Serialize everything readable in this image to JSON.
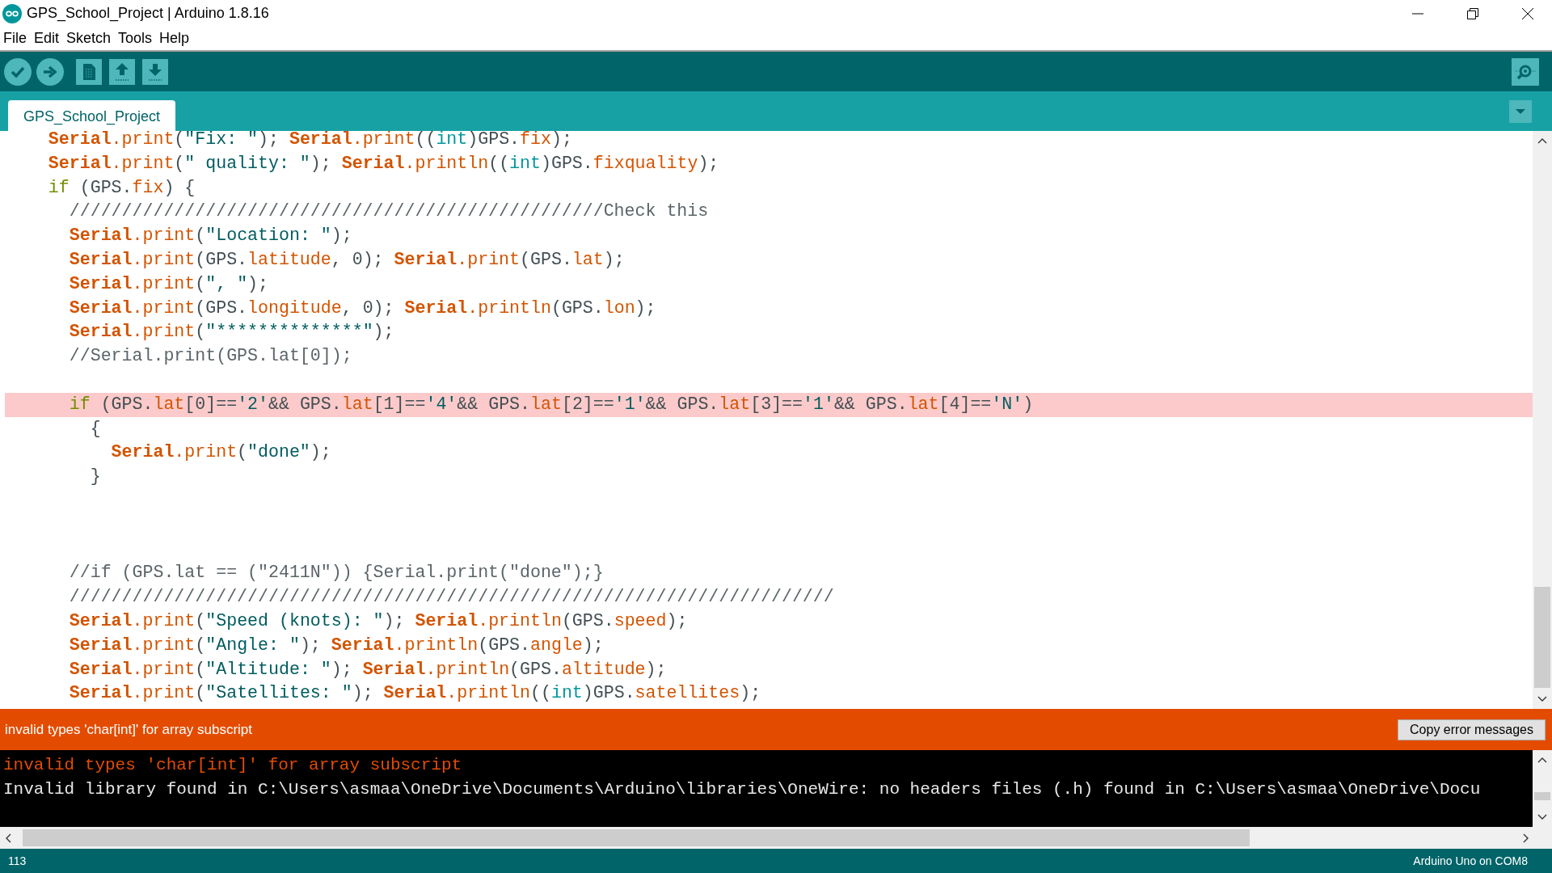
{
  "window": {
    "title": "GPS_School_Project | Arduino 1.8.16"
  },
  "menu": [
    "File",
    "Edit",
    "Sketch",
    "Tools",
    "Help"
  ],
  "tabs": [
    {
      "label": "GPS_School_Project",
      "selected": true
    }
  ],
  "code": [
    {
      "kind": "code",
      "error": false,
      "segments": [
        {
          "kind": "obj",
          "text": "    Serial"
        },
        {
          "kind": "fn",
          "text": ".print"
        },
        {
          "kind": "plain",
          "text": "("
        },
        {
          "kind": "str",
          "text": "\"Fix: \""
        },
        {
          "kind": "plain",
          "text": "); "
        },
        {
          "kind": "obj",
          "text": "Serial"
        },
        {
          "kind": "fn",
          "text": ".print"
        },
        {
          "kind": "plain",
          "text": "(("
        },
        {
          "kind": "type",
          "text": "int"
        },
        {
          "kind": "plain",
          "text": ")GPS."
        },
        {
          "kind": "prop",
          "text": "fix"
        },
        {
          "kind": "plain",
          "text": ");"
        }
      ]
    },
    {
      "kind": "code",
      "error": false,
      "segments": [
        {
          "kind": "obj",
          "text": "    Serial"
        },
        {
          "kind": "fn",
          "text": ".print"
        },
        {
          "kind": "plain",
          "text": "("
        },
        {
          "kind": "str",
          "text": "\" quality: \""
        },
        {
          "kind": "plain",
          "text": "); "
        },
        {
          "kind": "obj",
          "text": "Serial"
        },
        {
          "kind": "fn",
          "text": ".println"
        },
        {
          "kind": "plain",
          "text": "(("
        },
        {
          "kind": "type",
          "text": "int"
        },
        {
          "kind": "plain",
          "text": ")GPS."
        },
        {
          "kind": "prop",
          "text": "fixquality"
        },
        {
          "kind": "plain",
          "text": ");"
        }
      ]
    },
    {
      "kind": "code",
      "error": false,
      "segments": [
        {
          "kind": "kw",
          "text": "    if"
        },
        {
          "kind": "plain",
          "text": " (GPS."
        },
        {
          "kind": "prop",
          "text": "fix"
        },
        {
          "kind": "plain",
          "text": ") {"
        }
      ]
    },
    {
      "kind": "code",
      "error": false,
      "segments": [
        {
          "kind": "cmt",
          "text": "      ///////////////////////////////////////////////////Check this"
        }
      ]
    },
    {
      "kind": "code",
      "error": false,
      "segments": [
        {
          "kind": "obj",
          "text": "      Serial"
        },
        {
          "kind": "fn",
          "text": ".print"
        },
        {
          "kind": "plain",
          "text": "("
        },
        {
          "kind": "str",
          "text": "\"Location: \""
        },
        {
          "kind": "plain",
          "text": ");"
        }
      ]
    },
    {
      "kind": "code",
      "error": false,
      "segments": [
        {
          "kind": "obj",
          "text": "      Serial"
        },
        {
          "kind": "fn",
          "text": ".print"
        },
        {
          "kind": "plain",
          "text": "(GPS."
        },
        {
          "kind": "prop",
          "text": "latitude"
        },
        {
          "kind": "plain",
          "text": ", 0); "
        },
        {
          "kind": "obj",
          "text": "Serial"
        },
        {
          "kind": "fn",
          "text": ".print"
        },
        {
          "kind": "plain",
          "text": "(GPS."
        },
        {
          "kind": "prop",
          "text": "lat"
        },
        {
          "kind": "plain",
          "text": ");"
        }
      ]
    },
    {
      "kind": "code",
      "error": false,
      "segments": [
        {
          "kind": "obj",
          "text": "      Serial"
        },
        {
          "kind": "fn",
          "text": ".print"
        },
        {
          "kind": "plain",
          "text": "("
        },
        {
          "kind": "str",
          "text": "\", \""
        },
        {
          "kind": "plain",
          "text": ");"
        }
      ]
    },
    {
      "kind": "code",
      "error": false,
      "segments": [
        {
          "kind": "obj",
          "text": "      Serial"
        },
        {
          "kind": "fn",
          "text": ".print"
        },
        {
          "kind": "plain",
          "text": "(GPS."
        },
        {
          "kind": "prop",
          "text": "longitude"
        },
        {
          "kind": "plain",
          "text": ", 0); "
        },
        {
          "kind": "obj",
          "text": "Serial"
        },
        {
          "kind": "fn",
          "text": ".println"
        },
        {
          "kind": "plain",
          "text": "(GPS."
        },
        {
          "kind": "prop",
          "text": "lon"
        },
        {
          "kind": "plain",
          "text": ");"
        }
      ]
    },
    {
      "kind": "code",
      "error": false,
      "segments": [
        {
          "kind": "obj",
          "text": "      Serial"
        },
        {
          "kind": "fn",
          "text": ".print"
        },
        {
          "kind": "plain",
          "text": "("
        },
        {
          "kind": "str",
          "text": "\"**************\""
        },
        {
          "kind": "plain",
          "text": ");"
        }
      ]
    },
    {
      "kind": "code",
      "error": false,
      "segments": [
        {
          "kind": "cmt",
          "text": "      //Serial.print(GPS.lat[0]);"
        }
      ]
    },
    {
      "kind": "blank",
      "error": false
    },
    {
      "kind": "code",
      "error": true,
      "segments": [
        {
          "kind": "kw",
          "text": "      if"
        },
        {
          "kind": "plain",
          "text": " (GPS."
        },
        {
          "kind": "prop",
          "text": "lat"
        },
        {
          "kind": "plain",
          "text": "[0]=="
        },
        {
          "kind": "str",
          "text": "'2'"
        },
        {
          "kind": "plain",
          "text": "&& GPS."
        },
        {
          "kind": "prop",
          "text": "lat"
        },
        {
          "kind": "plain",
          "text": "[1]=="
        },
        {
          "kind": "str",
          "text": "'4'"
        },
        {
          "kind": "plain",
          "text": "&& GPS."
        },
        {
          "kind": "prop",
          "text": "lat"
        },
        {
          "kind": "plain",
          "text": "[2]=="
        },
        {
          "kind": "str",
          "text": "'1'"
        },
        {
          "kind": "plain",
          "text": "&& GPS."
        },
        {
          "kind": "prop",
          "text": "lat"
        },
        {
          "kind": "plain",
          "text": "[3]=="
        },
        {
          "kind": "str",
          "text": "'1'"
        },
        {
          "kind": "plain",
          "text": "&& GPS."
        },
        {
          "kind": "prop",
          "text": "lat"
        },
        {
          "kind": "plain",
          "text": "[4]=="
        },
        {
          "kind": "str",
          "text": "'N'"
        },
        {
          "kind": "plain",
          "text": ")"
        }
      ]
    },
    {
      "kind": "code",
      "error": false,
      "segments": [
        {
          "kind": "plain",
          "text": "        {"
        }
      ]
    },
    {
      "kind": "code",
      "error": false,
      "segments": [
        {
          "kind": "obj",
          "text": "          Serial"
        },
        {
          "kind": "fn",
          "text": ".print"
        },
        {
          "kind": "plain",
          "text": "("
        },
        {
          "kind": "str",
          "text": "\"done\""
        },
        {
          "kind": "plain",
          "text": ");"
        }
      ]
    },
    {
      "kind": "code",
      "error": false,
      "segments": [
        {
          "kind": "plain",
          "text": "        }"
        }
      ]
    },
    {
      "kind": "blank",
      "error": false
    },
    {
      "kind": "blank",
      "error": false
    },
    {
      "kind": "blank",
      "error": false
    },
    {
      "kind": "code",
      "error": false,
      "segments": [
        {
          "kind": "cmt",
          "text": "      //if (GPS.lat == (\"2411N\")) {Serial.print(\"done\");}"
        }
      ]
    },
    {
      "kind": "code",
      "error": false,
      "segments": [
        {
          "kind": "cmt",
          "text": "      /////////////////////////////////////////////////////////////////////////"
        }
      ]
    },
    {
      "kind": "code",
      "error": false,
      "segments": [
        {
          "kind": "obj",
          "text": "      Serial"
        },
        {
          "kind": "fn",
          "text": ".print"
        },
        {
          "kind": "plain",
          "text": "("
        },
        {
          "kind": "str",
          "text": "\"Speed (knots): \""
        },
        {
          "kind": "plain",
          "text": "); "
        },
        {
          "kind": "obj",
          "text": "Serial"
        },
        {
          "kind": "fn",
          "text": ".println"
        },
        {
          "kind": "plain",
          "text": "(GPS."
        },
        {
          "kind": "prop",
          "text": "speed"
        },
        {
          "kind": "plain",
          "text": ");"
        }
      ]
    },
    {
      "kind": "code",
      "error": false,
      "segments": [
        {
          "kind": "obj",
          "text": "      Serial"
        },
        {
          "kind": "fn",
          "text": ".print"
        },
        {
          "kind": "plain",
          "text": "("
        },
        {
          "kind": "str",
          "text": "\"Angle: \""
        },
        {
          "kind": "plain",
          "text": "); "
        },
        {
          "kind": "obj",
          "text": "Serial"
        },
        {
          "kind": "fn",
          "text": ".println"
        },
        {
          "kind": "plain",
          "text": "(GPS."
        },
        {
          "kind": "prop",
          "text": "angle"
        },
        {
          "kind": "plain",
          "text": ");"
        }
      ]
    },
    {
      "kind": "code",
      "error": false,
      "segments": [
        {
          "kind": "obj",
          "text": "      Serial"
        },
        {
          "kind": "fn",
          "text": ".print"
        },
        {
          "kind": "plain",
          "text": "("
        },
        {
          "kind": "str",
          "text": "\"Altitude: \""
        },
        {
          "kind": "plain",
          "text": "); "
        },
        {
          "kind": "obj",
          "text": "Serial"
        },
        {
          "kind": "fn",
          "text": ".println"
        },
        {
          "kind": "plain",
          "text": "(GPS."
        },
        {
          "kind": "prop",
          "text": "altitude"
        },
        {
          "kind": "plain",
          "text": ");"
        }
      ]
    },
    {
      "kind": "code",
      "error": false,
      "segments": [
        {
          "kind": "obj",
          "text": "      Serial"
        },
        {
          "kind": "fn",
          "text": ".print"
        },
        {
          "kind": "plain",
          "text": "("
        },
        {
          "kind": "str",
          "text": "\"Satellites: \""
        },
        {
          "kind": "plain",
          "text": "); "
        },
        {
          "kind": "obj",
          "text": "Serial"
        },
        {
          "kind": "fn",
          "text": ".println"
        },
        {
          "kind": "plain",
          "text": "(("
        },
        {
          "kind": "type",
          "text": "int"
        },
        {
          "kind": "plain",
          "text": ")GPS."
        },
        {
          "kind": "prop",
          "text": "satellites"
        },
        {
          "kind": "plain",
          "text": ");"
        }
      ]
    }
  ],
  "error_bar": {
    "message": "invalid types 'char[int]' for array subscript",
    "button": "Copy error messages"
  },
  "console": [
    {
      "kind": "error",
      "text": "invalid types 'char[int]' for array subscript"
    },
    {
      "kind": "info",
      "text": "Invalid library found in C:\\Users\\asmaa\\OneDrive\\Documents\\Arduino\\libraries\\OneWire: no headers files (.h) found in C:\\Users\\asmaa\\OneDrive\\Docu"
    }
  ],
  "status_bar": {
    "line": "113",
    "board": "Arduino Uno on COM8"
  }
}
